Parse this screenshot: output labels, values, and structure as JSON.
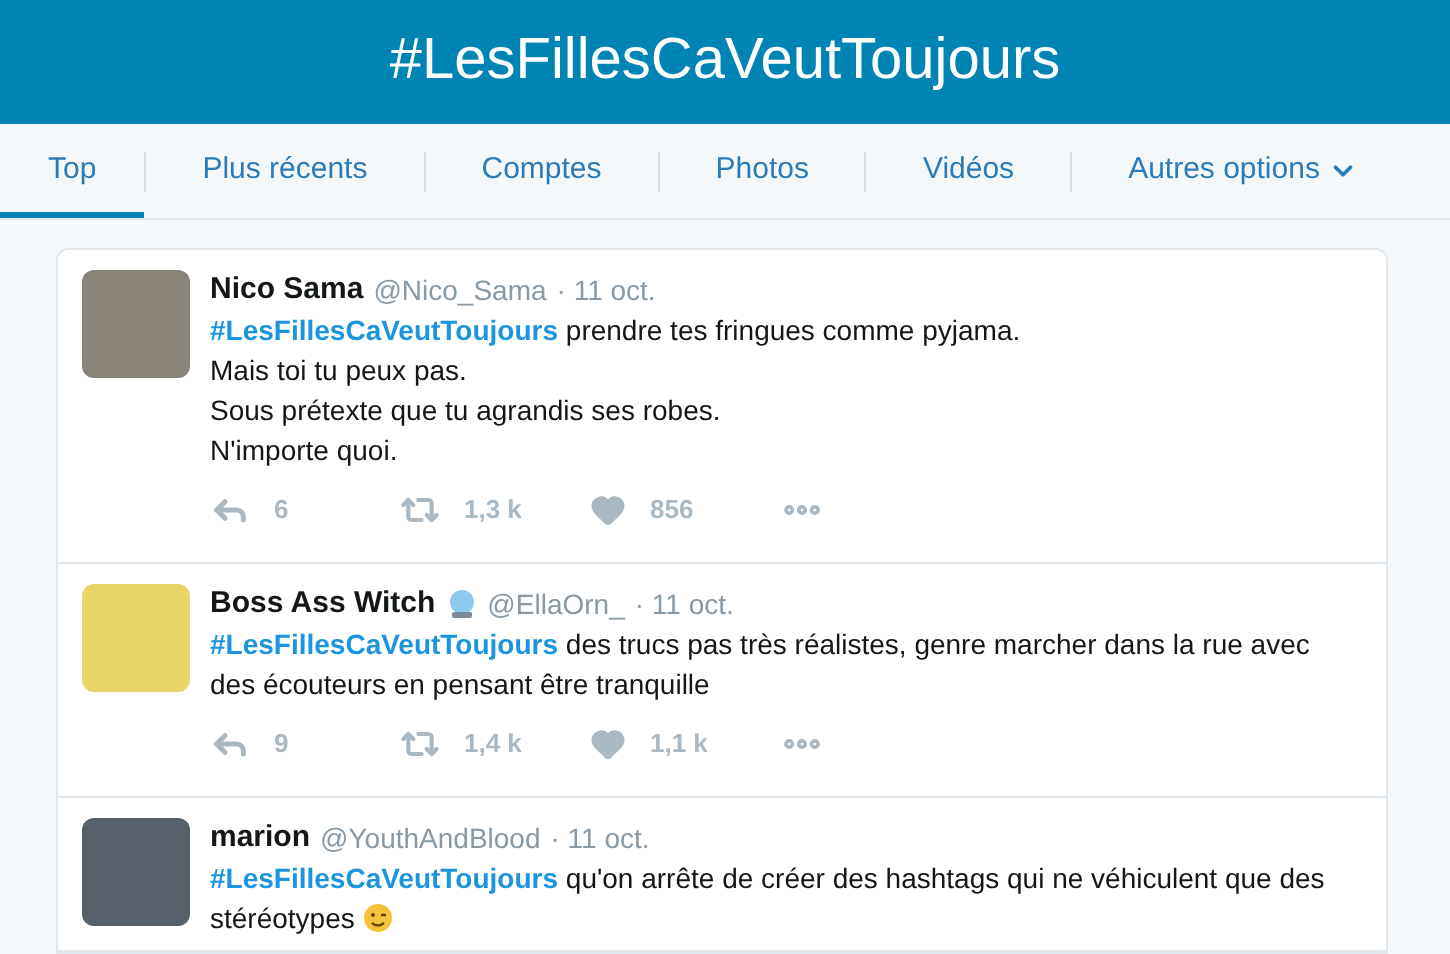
{
  "header": {
    "title": "#LesFillesCaVeutToujours"
  },
  "tabs": [
    {
      "label": "Top",
      "selected": true,
      "dropdown": false
    },
    {
      "label": "Plus récents",
      "selected": false,
      "dropdown": false
    },
    {
      "label": "Comptes",
      "selected": false,
      "dropdown": false
    },
    {
      "label": "Photos",
      "selected": false,
      "dropdown": false
    },
    {
      "label": "Vidéos",
      "selected": false,
      "dropdown": false
    },
    {
      "label": "Autres options",
      "selected": false,
      "dropdown": true
    }
  ],
  "tweets": [
    {
      "name": "Nico Sama",
      "name_emoji": false,
      "handle": "@Nico_Sama",
      "date": "· 11 oct.",
      "text": "**#LesFillesCaVeutToujours** prendre tes fringues comme pyjama.\nMais toi tu peux pas.\nSous prétexte que tu agrandis ses robes.\nN'importe quoi.",
      "text_emoji": false,
      "replies": "6",
      "retweets": "1,3 k",
      "likes": "856"
    },
    {
      "name": "Boss Ass Witch",
      "name_emoji": true,
      "handle": "@EllaOrn_",
      "date": "· 11 oct.",
      "text": "**#LesFillesCaVeutToujours** des trucs pas très réalistes, genre marcher dans la rue avec des écouteurs en pensant être tranquille",
      "text_emoji": false,
      "replies": "9",
      "retweets": "1,4 k",
      "likes": "1,1 k"
    },
    {
      "name": "marion",
      "name_emoji": false,
      "handle": "@YouthAndBlood",
      "date": "· 11 oct.",
      "text": "**#LesFillesCaVeutToujours** qu'on arrête de créer des hashtags qui ne véhiculent que des stéréotypes",
      "text_emoji": true
    }
  ]
}
